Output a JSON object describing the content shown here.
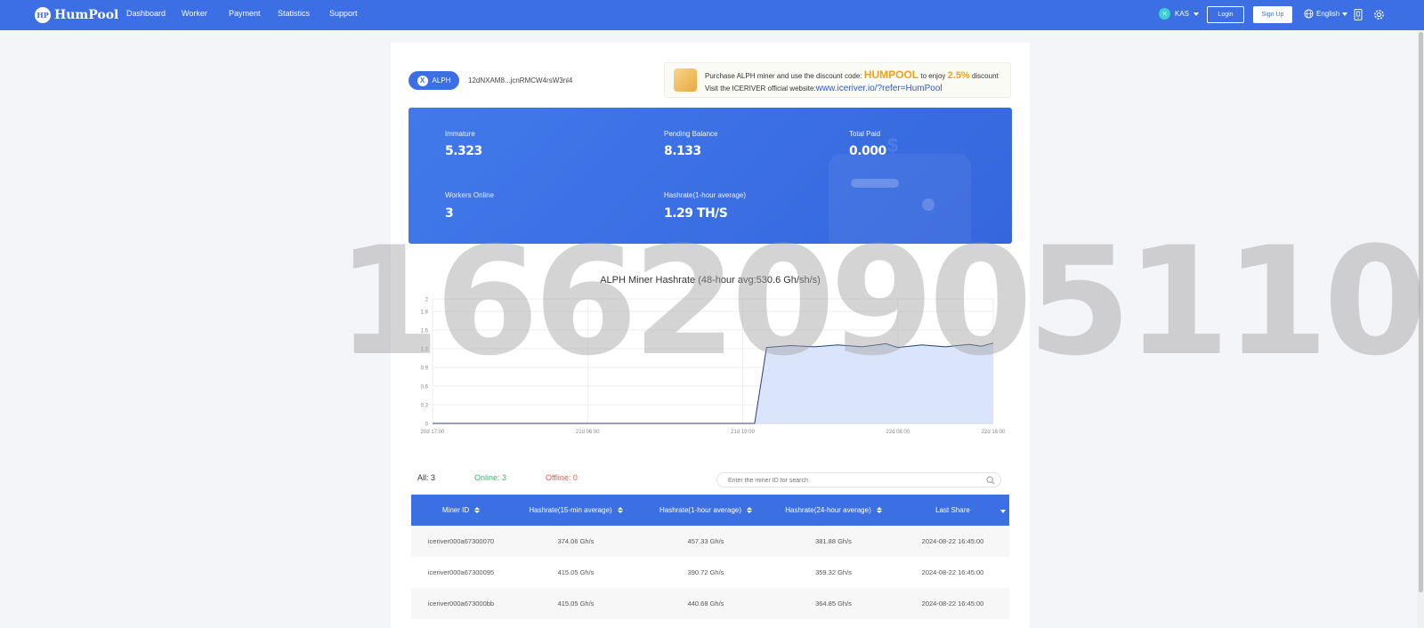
{
  "nav": {
    "logo_mark": "HP",
    "brand": "HumPool",
    "links": [
      "Dashboard",
      "Worker",
      "Payment",
      "Statistics",
      "Support"
    ],
    "coin": "KAS",
    "login": "Login",
    "signup": "Sign Up",
    "language": "English"
  },
  "account": {
    "coin": "ALPH",
    "address": "12dNXAM8...jcnRMCW4rsW3nl4"
  },
  "promo": {
    "text1": "Purchase ALPH miner and use the discount code:",
    "code": "HUMPOOL",
    "text2": "to enjoy",
    "percent": "2.5%",
    "text3": "discount",
    "visit": "Visit the ICERIVER official website:",
    "link": "www.iceriver.io/?refer=HumPool"
  },
  "stats": {
    "immature_label": "Immature",
    "immature_value": "5.323",
    "pending_label": "Pending Balance",
    "pending_value": "8.133",
    "paid_label": "Total Paid",
    "paid_value": "0.000",
    "workers_label": "Workers Online",
    "workers_value": "3",
    "hashrate_label": "Hashrate(1-hour average)",
    "hashrate_value": "1.29 TH/S"
  },
  "watermark": "16620905110",
  "chart_data": {
    "type": "area",
    "title": "ALPH Miner Hashrate (48-hour avg:530.6 Gh/sh/s)",
    "xlabel": "",
    "ylabel": "",
    "ylim": [
      0,
      2
    ],
    "yticks": [
      "0",
      "0.3",
      "0.6",
      "0.9",
      "1.2",
      "1.5",
      "1.8",
      "2"
    ],
    "xticks": [
      "20d 17:00",
      "21d 06:00",
      "21d 19:00",
      "22d 08:00",
      "22d 16:00"
    ],
    "grid": true,
    "color": "#2c3e7a",
    "fill": "#d6e2fb",
    "series": [
      {
        "x": [
          "20d 17:00",
          "21d 06:00",
          "21d 19:00",
          "21d 20:00",
          "21d 21:00",
          "21d 23:00",
          "22d 01:00",
          "22d 03:00",
          "22d 05:00",
          "22d 07:00",
          "22d 08:00",
          "22d 10:00",
          "22d 12:00",
          "22d 14:00",
          "22d 15:00",
          "22d 16:00"
        ],
        "values": [
          0,
          0,
          0,
          0,
          1.22,
          1.25,
          1.23,
          1.26,
          1.23,
          1.28,
          1.22,
          1.26,
          1.23,
          1.27,
          1.24,
          1.29
        ]
      }
    ]
  },
  "filters": {
    "all": "All: 3",
    "online": "Online: 3",
    "offline": "Offline: 0",
    "search_placeholder": "Enter the miner ID for search"
  },
  "table": {
    "headers": [
      "Miner ID",
      "Hashrate(15-min average)",
      "Hashrate(1-hour average)",
      "Hashrate(24-hour average)",
      "Last Share"
    ],
    "rows": [
      [
        "iceriver000a67300070",
        "374.06 Gh/s",
        "457.33 Gh/s",
        "381.88 Gh/s",
        "2024-08-22 16:45:00"
      ],
      [
        "iceriver000a67300095",
        "415.05 Gh/s",
        "390.72 Gh/s",
        "359.32 Gh/s",
        "2024-08-22 16:45:00"
      ],
      [
        "iceriver000a673000bb",
        "415.05 Gh/s",
        "440.68 Gh/s",
        "364.85 Gh/s",
        "2024-08-22 16:45:00"
      ]
    ]
  },
  "colors": {
    "primary": "#3b6fe3",
    "online": "#3cb371",
    "offline": "#e05a4f",
    "accent": "#f0a21a"
  }
}
